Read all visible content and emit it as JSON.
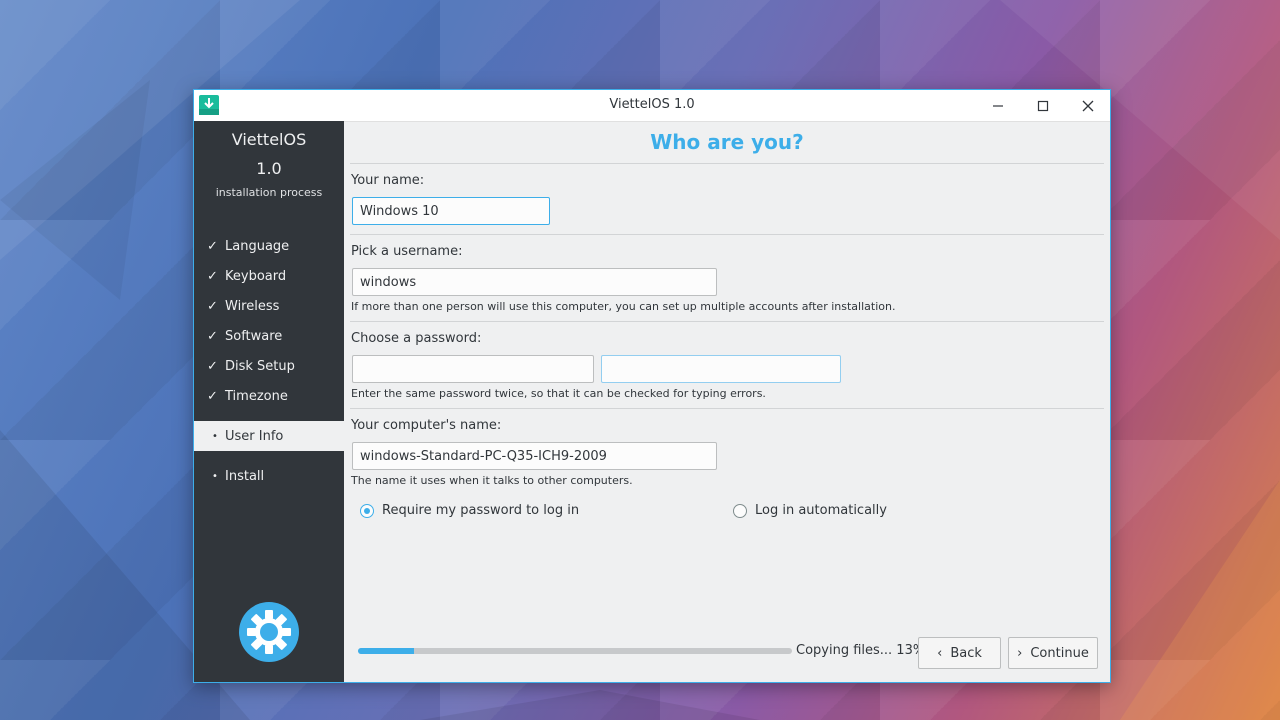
{
  "window": {
    "title": "ViettelOS 1.0"
  },
  "sidebar": {
    "product": "ViettelOS",
    "version": "1.0",
    "subtitle": "installation process",
    "steps": [
      {
        "label": "Language",
        "mark": "✓",
        "state": "done"
      },
      {
        "label": "Keyboard",
        "mark": "✓",
        "state": "done"
      },
      {
        "label": "Wireless",
        "mark": "✓",
        "state": "done"
      },
      {
        "label": "Software",
        "mark": "✓",
        "state": "done"
      },
      {
        "label": "Disk Setup",
        "mark": "✓",
        "state": "done"
      },
      {
        "label": "Timezone",
        "mark": "✓",
        "state": "done"
      },
      {
        "label": "User Info",
        "mark": "•",
        "state": "current"
      },
      {
        "label": "Install",
        "mark": "•",
        "state": "pending"
      }
    ]
  },
  "main": {
    "heading": "Who are you?",
    "name_label": "Your name:",
    "name_value": "Windows 10",
    "username_label": "Pick a username:",
    "username_value": "windows",
    "username_hint": "If more than one person will use this computer, you can set up multiple accounts after installation.",
    "password_label": "Choose a password:",
    "password_value": "",
    "password_confirm_value": "",
    "password_hint": "Enter the same password twice, so that it can be checked for typing errors.",
    "computer_label": "Your computer's name:",
    "computer_value": "windows-Standard-PC-Q35-ICH9-2009",
    "computer_hint": "The name it uses when it talks to other computers.",
    "login_options": {
      "require_password": "Require my password to log in",
      "auto_login": "Log in automatically",
      "selected": "require_password"
    }
  },
  "footer": {
    "progress_text": "Copying files... 13%",
    "progress_percent": 13,
    "back_label": "Back",
    "continue_label": "Continue"
  },
  "colors": {
    "accent": "#3daee9",
    "sidebar_bg": "#31363b",
    "window_bg": "#eff0f1"
  }
}
